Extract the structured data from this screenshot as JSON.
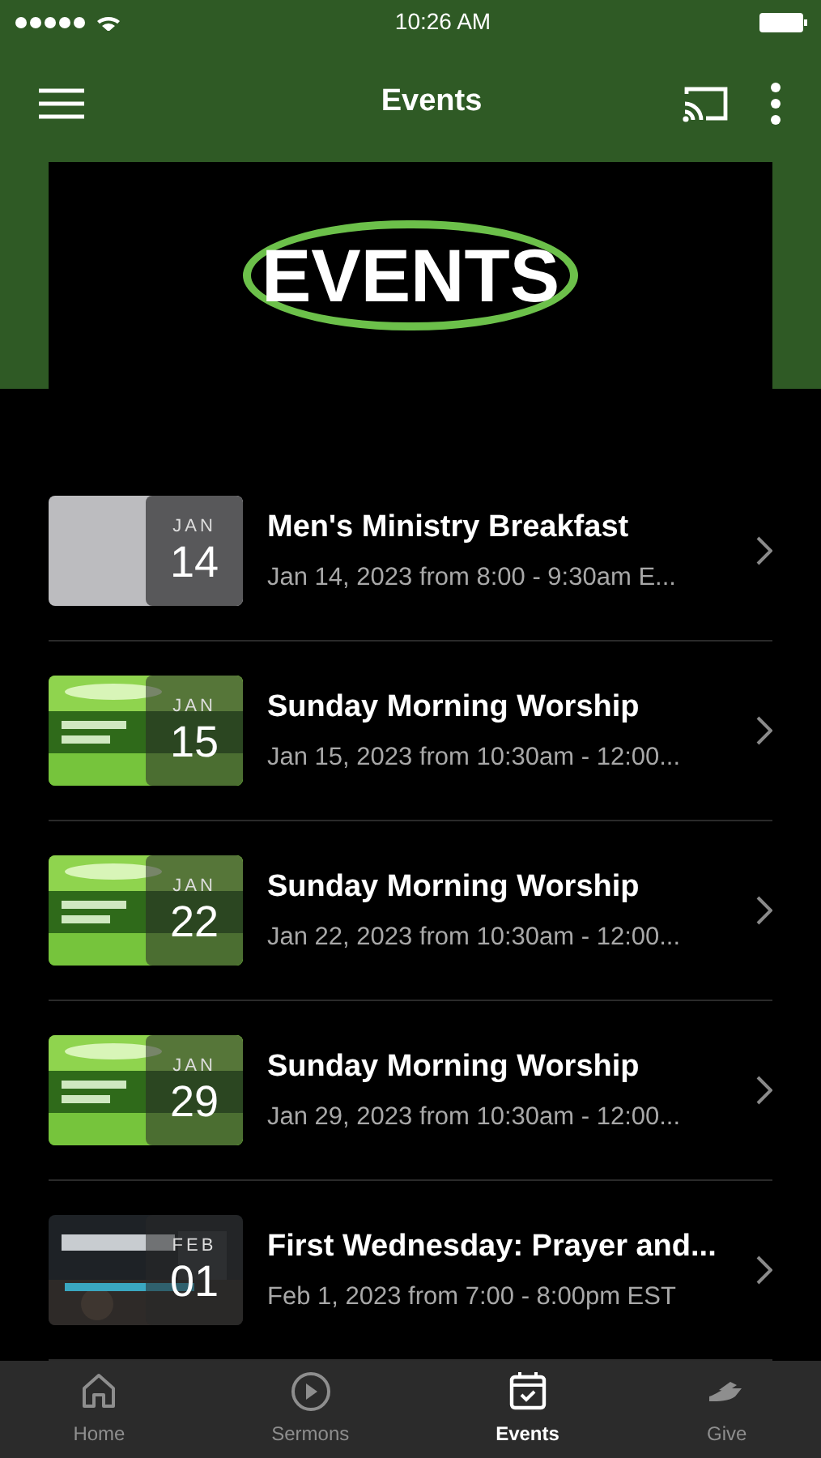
{
  "status_bar": {
    "time": "10:26 AM"
  },
  "header": {
    "title": "Events"
  },
  "banner": {
    "title": "EVENTS"
  },
  "events": [
    {
      "kind": "blank",
      "month": "JAN",
      "day": "14",
      "title": "Men's Ministry Breakfast",
      "subtitle": "Jan 14, 2023 from 8:00 - 9:30am E..."
    },
    {
      "kind": "picture",
      "month": "JAN",
      "day": "15",
      "title": "Sunday Morning Worship",
      "subtitle": "Jan 15, 2023 from 10:30am - 12:00..."
    },
    {
      "kind": "picture",
      "month": "JAN",
      "day": "22",
      "title": "Sunday Morning Worship",
      "subtitle": "Jan 22, 2023 from 10:30am - 12:00..."
    },
    {
      "kind": "picture",
      "month": "JAN",
      "day": "29",
      "title": "Sunday Morning Worship",
      "subtitle": "Jan 29, 2023 from 10:30am - 12:00..."
    },
    {
      "kind": "dark-picture",
      "month": "FEB",
      "day": "01",
      "title": "First Wednesday: Prayer and...",
      "subtitle": "Feb 1, 2023 from 7:00 - 8:00pm EST"
    }
  ],
  "tabs": [
    {
      "kind": "home",
      "label": "Home",
      "selected": false
    },
    {
      "kind": "sermons",
      "label": "Sermons",
      "selected": false
    },
    {
      "kind": "events",
      "label": "Events",
      "selected": true
    },
    {
      "kind": "give",
      "label": "Give",
      "selected": false
    }
  ]
}
